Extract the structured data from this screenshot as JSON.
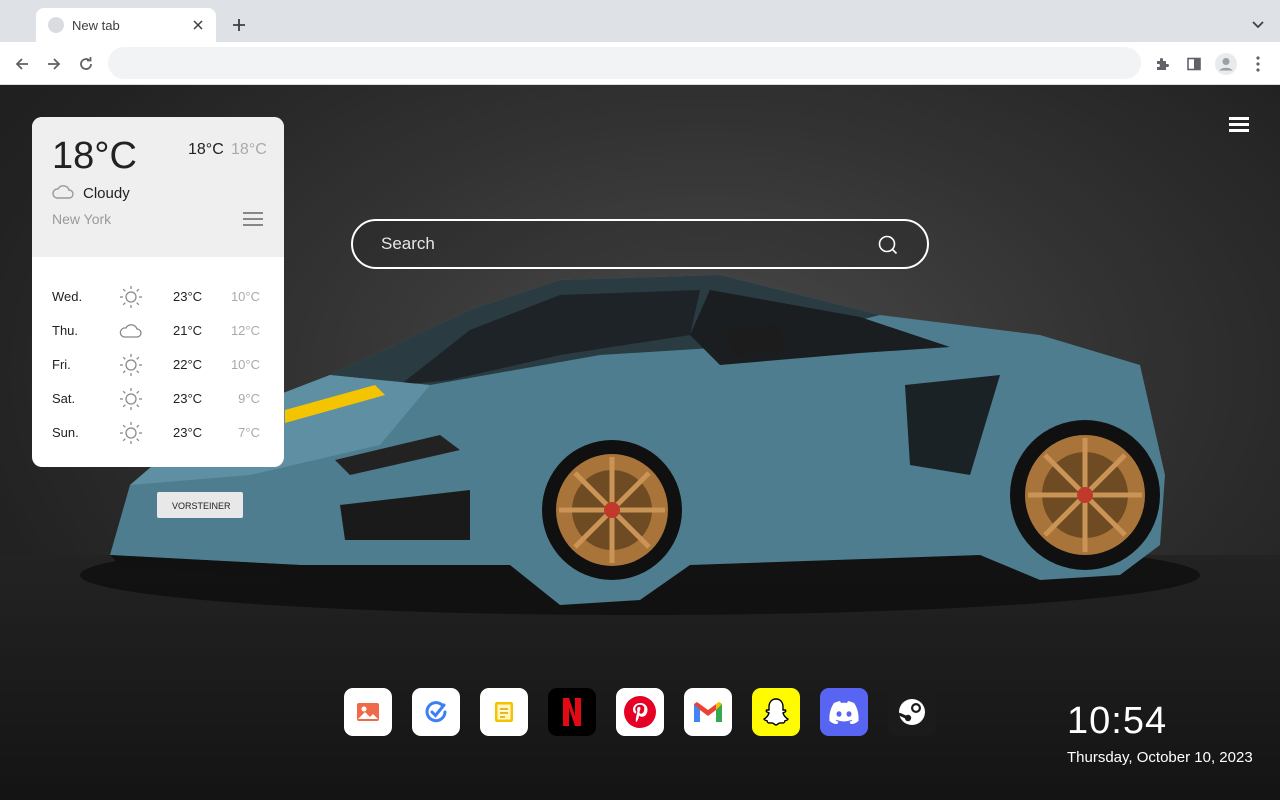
{
  "browser": {
    "tab_title": "New tab",
    "omnibox_value": "",
    "icons": [
      "close-icon",
      "plus-icon",
      "chevron-down-icon",
      "back-arrow-icon",
      "forward-arrow-icon",
      "reload-icon",
      "extensions-icon",
      "side-panel-icon",
      "profile-avatar-icon",
      "kebab-menu-icon"
    ]
  },
  "weather": {
    "temp": "18°C",
    "high": "18°C",
    "low": "18°C",
    "condition": "Cloudy",
    "condition_icon": "cloud-icon",
    "city": "New York",
    "forecast": [
      {
        "day": "Wed.",
        "icon": "sun-icon",
        "high": "23°C",
        "low": "10°C"
      },
      {
        "day": "Thu.",
        "icon": "cloud-icon",
        "high": "21°C",
        "low": "12°C"
      },
      {
        "day": "Fri.",
        "icon": "sun-icon",
        "high": "22°C",
        "low": "10°C"
      },
      {
        "day": "Sat.",
        "icon": "sun-icon",
        "high": "23°C",
        "low": "9°C"
      },
      {
        "day": "Sun.",
        "icon": "sun-icon",
        "high": "23°C",
        "low": "7°C"
      }
    ]
  },
  "search": {
    "placeholder": "Search"
  },
  "background": {
    "car_plate": "VORSTEINER"
  },
  "shortcuts": [
    {
      "name": "photos",
      "icon": "photos-icon",
      "bg": "#ffffff"
    },
    {
      "name": "tasks",
      "icon": "tasks-icon",
      "bg": "#ffffff"
    },
    {
      "name": "notes",
      "icon": "notes-icon",
      "bg": "#ffffff"
    },
    {
      "name": "netflix",
      "icon": "netflix-icon",
      "bg": "#000000"
    },
    {
      "name": "pinterest",
      "icon": "pinterest-icon",
      "bg": "#ffffff"
    },
    {
      "name": "gmail",
      "icon": "gmail-icon",
      "bg": "#ffffff"
    },
    {
      "name": "snapchat",
      "icon": "snapchat-icon",
      "bg": "#fffc00"
    },
    {
      "name": "discord",
      "icon": "discord-icon",
      "bg": "#5865f2"
    },
    {
      "name": "steam",
      "icon": "steam-icon",
      "bg": "#1b1b1b"
    }
  ],
  "clock": {
    "time": "10:54",
    "date": "Thursday, October 10, 2023"
  },
  "colors": {
    "car_body": "#4d7d8f",
    "wheel": "#a8743a",
    "accent_stripe": "#f5c400"
  }
}
